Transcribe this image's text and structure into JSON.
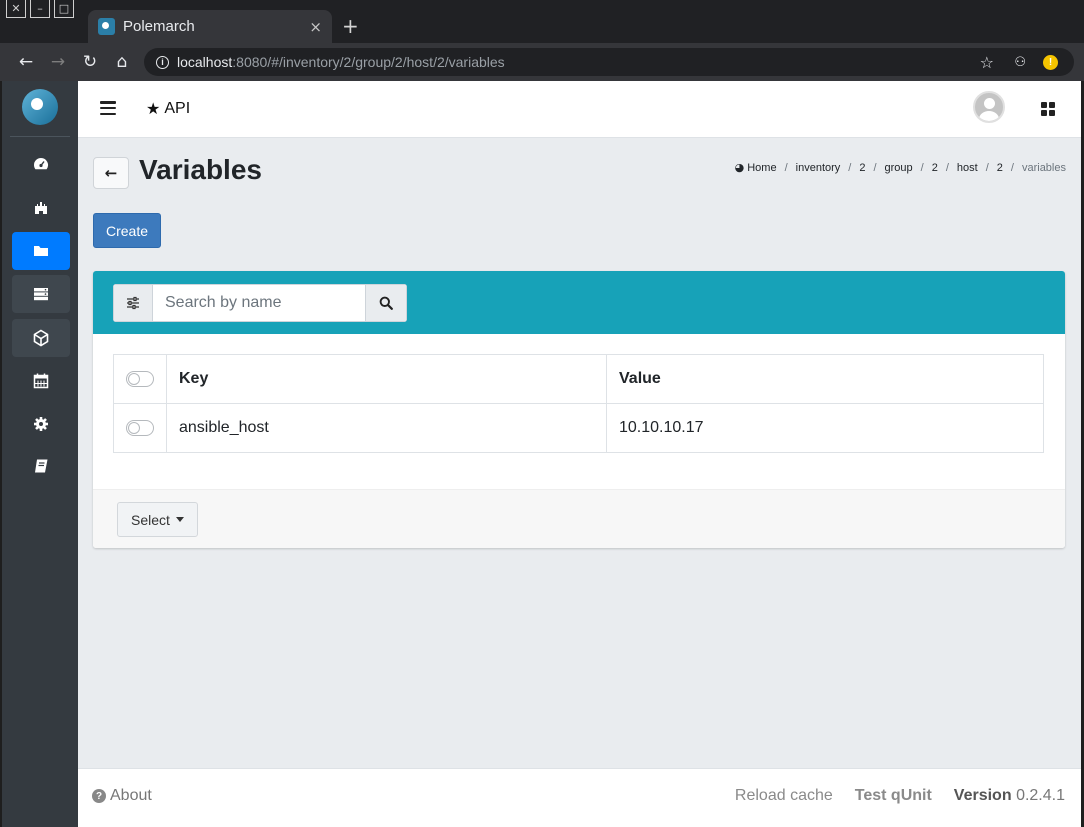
{
  "browser": {
    "tab_title": "Polemarch",
    "tab_close": "×",
    "new_tab": "+",
    "url_host": "localhost",
    "url_path": ":8080/#/inventory/2/group/2/host/2/variables"
  },
  "topbar": {
    "api_label": "API"
  },
  "page": {
    "title": "Variables",
    "create_label": "Create"
  },
  "breadcrumb": {
    "items": [
      "Home",
      "inventory",
      "2",
      "group",
      "2",
      "host",
      "2",
      "variables"
    ]
  },
  "search": {
    "placeholder": "Search by name"
  },
  "table": {
    "headers": [
      "Key",
      "Value"
    ],
    "rows": [
      {
        "key": "ansible_host",
        "value": "10.10.10.17"
      }
    ]
  },
  "card_footer": {
    "select_label": "Select"
  },
  "footer": {
    "about": "About",
    "reload": "Reload cache",
    "qunit": "Test qUnit",
    "version_label": "Version",
    "version_num": "0.2.4.1"
  },
  "sidebar": {
    "icons": [
      "dashboard-icon",
      "projects-icon",
      "inventory-icon",
      "hosts-icon",
      "templates-icon",
      "calendar-icon",
      "settings-icon",
      "docs-icon"
    ]
  },
  "colors": {
    "header_teal": "#17a2b8",
    "create_blue": "#3d7abd",
    "active_blue": "#007bff",
    "sidebar_dark": "#343a40"
  }
}
